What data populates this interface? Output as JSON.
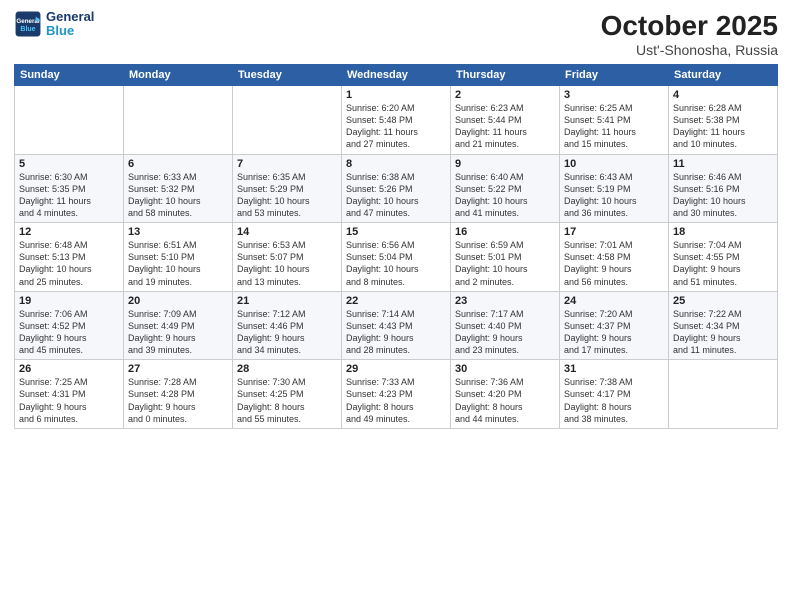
{
  "header": {
    "logo_line1": "General",
    "logo_line2": "Blue",
    "month": "October 2025",
    "location": "Ust'-Shonosha, Russia"
  },
  "weekdays": [
    "Sunday",
    "Monday",
    "Tuesday",
    "Wednesday",
    "Thursday",
    "Friday",
    "Saturday"
  ],
  "weeks": [
    [
      {
        "day": "",
        "info": ""
      },
      {
        "day": "",
        "info": ""
      },
      {
        "day": "",
        "info": ""
      },
      {
        "day": "1",
        "info": "Sunrise: 6:20 AM\nSunset: 5:48 PM\nDaylight: 11 hours\nand 27 minutes."
      },
      {
        "day": "2",
        "info": "Sunrise: 6:23 AM\nSunset: 5:44 PM\nDaylight: 11 hours\nand 21 minutes."
      },
      {
        "day": "3",
        "info": "Sunrise: 6:25 AM\nSunset: 5:41 PM\nDaylight: 11 hours\nand 15 minutes."
      },
      {
        "day": "4",
        "info": "Sunrise: 6:28 AM\nSunset: 5:38 PM\nDaylight: 11 hours\nand 10 minutes."
      }
    ],
    [
      {
        "day": "5",
        "info": "Sunrise: 6:30 AM\nSunset: 5:35 PM\nDaylight: 11 hours\nand 4 minutes."
      },
      {
        "day": "6",
        "info": "Sunrise: 6:33 AM\nSunset: 5:32 PM\nDaylight: 10 hours\nand 58 minutes."
      },
      {
        "day": "7",
        "info": "Sunrise: 6:35 AM\nSunset: 5:29 PM\nDaylight: 10 hours\nand 53 minutes."
      },
      {
        "day": "8",
        "info": "Sunrise: 6:38 AM\nSunset: 5:26 PM\nDaylight: 10 hours\nand 47 minutes."
      },
      {
        "day": "9",
        "info": "Sunrise: 6:40 AM\nSunset: 5:22 PM\nDaylight: 10 hours\nand 41 minutes."
      },
      {
        "day": "10",
        "info": "Sunrise: 6:43 AM\nSunset: 5:19 PM\nDaylight: 10 hours\nand 36 minutes."
      },
      {
        "day": "11",
        "info": "Sunrise: 6:46 AM\nSunset: 5:16 PM\nDaylight: 10 hours\nand 30 minutes."
      }
    ],
    [
      {
        "day": "12",
        "info": "Sunrise: 6:48 AM\nSunset: 5:13 PM\nDaylight: 10 hours\nand 25 minutes."
      },
      {
        "day": "13",
        "info": "Sunrise: 6:51 AM\nSunset: 5:10 PM\nDaylight: 10 hours\nand 19 minutes."
      },
      {
        "day": "14",
        "info": "Sunrise: 6:53 AM\nSunset: 5:07 PM\nDaylight: 10 hours\nand 13 minutes."
      },
      {
        "day": "15",
        "info": "Sunrise: 6:56 AM\nSunset: 5:04 PM\nDaylight: 10 hours\nand 8 minutes."
      },
      {
        "day": "16",
        "info": "Sunrise: 6:59 AM\nSunset: 5:01 PM\nDaylight: 10 hours\nand 2 minutes."
      },
      {
        "day": "17",
        "info": "Sunrise: 7:01 AM\nSunset: 4:58 PM\nDaylight: 9 hours\nand 56 minutes."
      },
      {
        "day": "18",
        "info": "Sunrise: 7:04 AM\nSunset: 4:55 PM\nDaylight: 9 hours\nand 51 minutes."
      }
    ],
    [
      {
        "day": "19",
        "info": "Sunrise: 7:06 AM\nSunset: 4:52 PM\nDaylight: 9 hours\nand 45 minutes."
      },
      {
        "day": "20",
        "info": "Sunrise: 7:09 AM\nSunset: 4:49 PM\nDaylight: 9 hours\nand 39 minutes."
      },
      {
        "day": "21",
        "info": "Sunrise: 7:12 AM\nSunset: 4:46 PM\nDaylight: 9 hours\nand 34 minutes."
      },
      {
        "day": "22",
        "info": "Sunrise: 7:14 AM\nSunset: 4:43 PM\nDaylight: 9 hours\nand 28 minutes."
      },
      {
        "day": "23",
        "info": "Sunrise: 7:17 AM\nSunset: 4:40 PM\nDaylight: 9 hours\nand 23 minutes."
      },
      {
        "day": "24",
        "info": "Sunrise: 7:20 AM\nSunset: 4:37 PM\nDaylight: 9 hours\nand 17 minutes."
      },
      {
        "day": "25",
        "info": "Sunrise: 7:22 AM\nSunset: 4:34 PM\nDaylight: 9 hours\nand 11 minutes."
      }
    ],
    [
      {
        "day": "26",
        "info": "Sunrise: 7:25 AM\nSunset: 4:31 PM\nDaylight: 9 hours\nand 6 minutes."
      },
      {
        "day": "27",
        "info": "Sunrise: 7:28 AM\nSunset: 4:28 PM\nDaylight: 9 hours\nand 0 minutes."
      },
      {
        "day": "28",
        "info": "Sunrise: 7:30 AM\nSunset: 4:25 PM\nDaylight: 8 hours\nand 55 minutes."
      },
      {
        "day": "29",
        "info": "Sunrise: 7:33 AM\nSunset: 4:23 PM\nDaylight: 8 hours\nand 49 minutes."
      },
      {
        "day": "30",
        "info": "Sunrise: 7:36 AM\nSunset: 4:20 PM\nDaylight: 8 hours\nand 44 minutes."
      },
      {
        "day": "31",
        "info": "Sunrise: 7:38 AM\nSunset: 4:17 PM\nDaylight: 8 hours\nand 38 minutes."
      },
      {
        "day": "",
        "info": ""
      }
    ]
  ]
}
